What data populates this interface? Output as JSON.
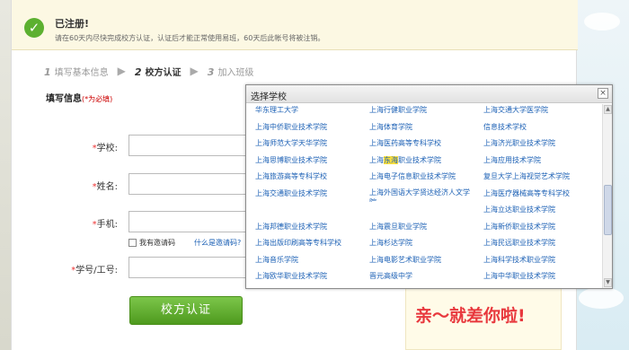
{
  "notice": {
    "title": "已注册!",
    "desc": "请在60天内尽快完成校方认证，认证后才能正常使用易班，60天后此帐号将被注销。"
  },
  "steps": [
    {
      "num": "1",
      "label": "填写基本信息"
    },
    {
      "num": "2",
      "label": "校方认证"
    },
    {
      "num": "3",
      "label": "加入班级"
    }
  ],
  "section": {
    "title": "填写信息",
    "required": "(*为必填)"
  },
  "form": {
    "school_label": "学校:",
    "name_label": "姓名:",
    "phone_label": "手机:",
    "id_label": "学号/工号:",
    "star": "*",
    "invite_label": "我有邀请码",
    "invite_link": "什么是邀请码?",
    "submit": "校方认证"
  },
  "promo": {
    "slogan": "亲～就差你啦!"
  },
  "modal": {
    "title": "选择学校",
    "close": "×",
    "highlight": "东海",
    "schools": [
      [
        "华东理工大学",
        "上海行健职业学院",
        "上海交通大学医学院"
      ],
      [
        "上海中侨职业技术学院",
        "上海体育学院",
        "信息技术学校"
      ],
      [
        "上海师范大学天华学院",
        "上海医药高等专科学校",
        "上海济光职业技术学院"
      ],
      [
        "上海思博职业技术学院",
        "上海东海职业技术学院",
        "上海应用技术学院"
      ],
      [
        "上海旅游高等专科学校",
        "上海电子信息职业技术学院",
        "复旦大学上海视觉艺术学院"
      ],
      [
        "上海交通职业技术学院",
        "上海外国语大学贤达经济人文学院",
        "上海医疗器械高等专科学校"
      ],
      [
        "",
        "",
        "上海立达职业技术学院"
      ],
      [
        "上海邦德职业技术学院",
        "上海震旦职业学院",
        "上海新侨职业技术学院"
      ],
      [
        "上海出版印刷高等专科学校",
        "上海杉达学院",
        "上海民远职业技术学院"
      ],
      [
        "上海音乐学院",
        "上海电影艺术职业学院",
        "上海科学技术职业学院"
      ],
      [
        "上海欧华职业技术学院",
        "晋元高级中学",
        "上海中华职业技术学院"
      ]
    ]
  }
}
